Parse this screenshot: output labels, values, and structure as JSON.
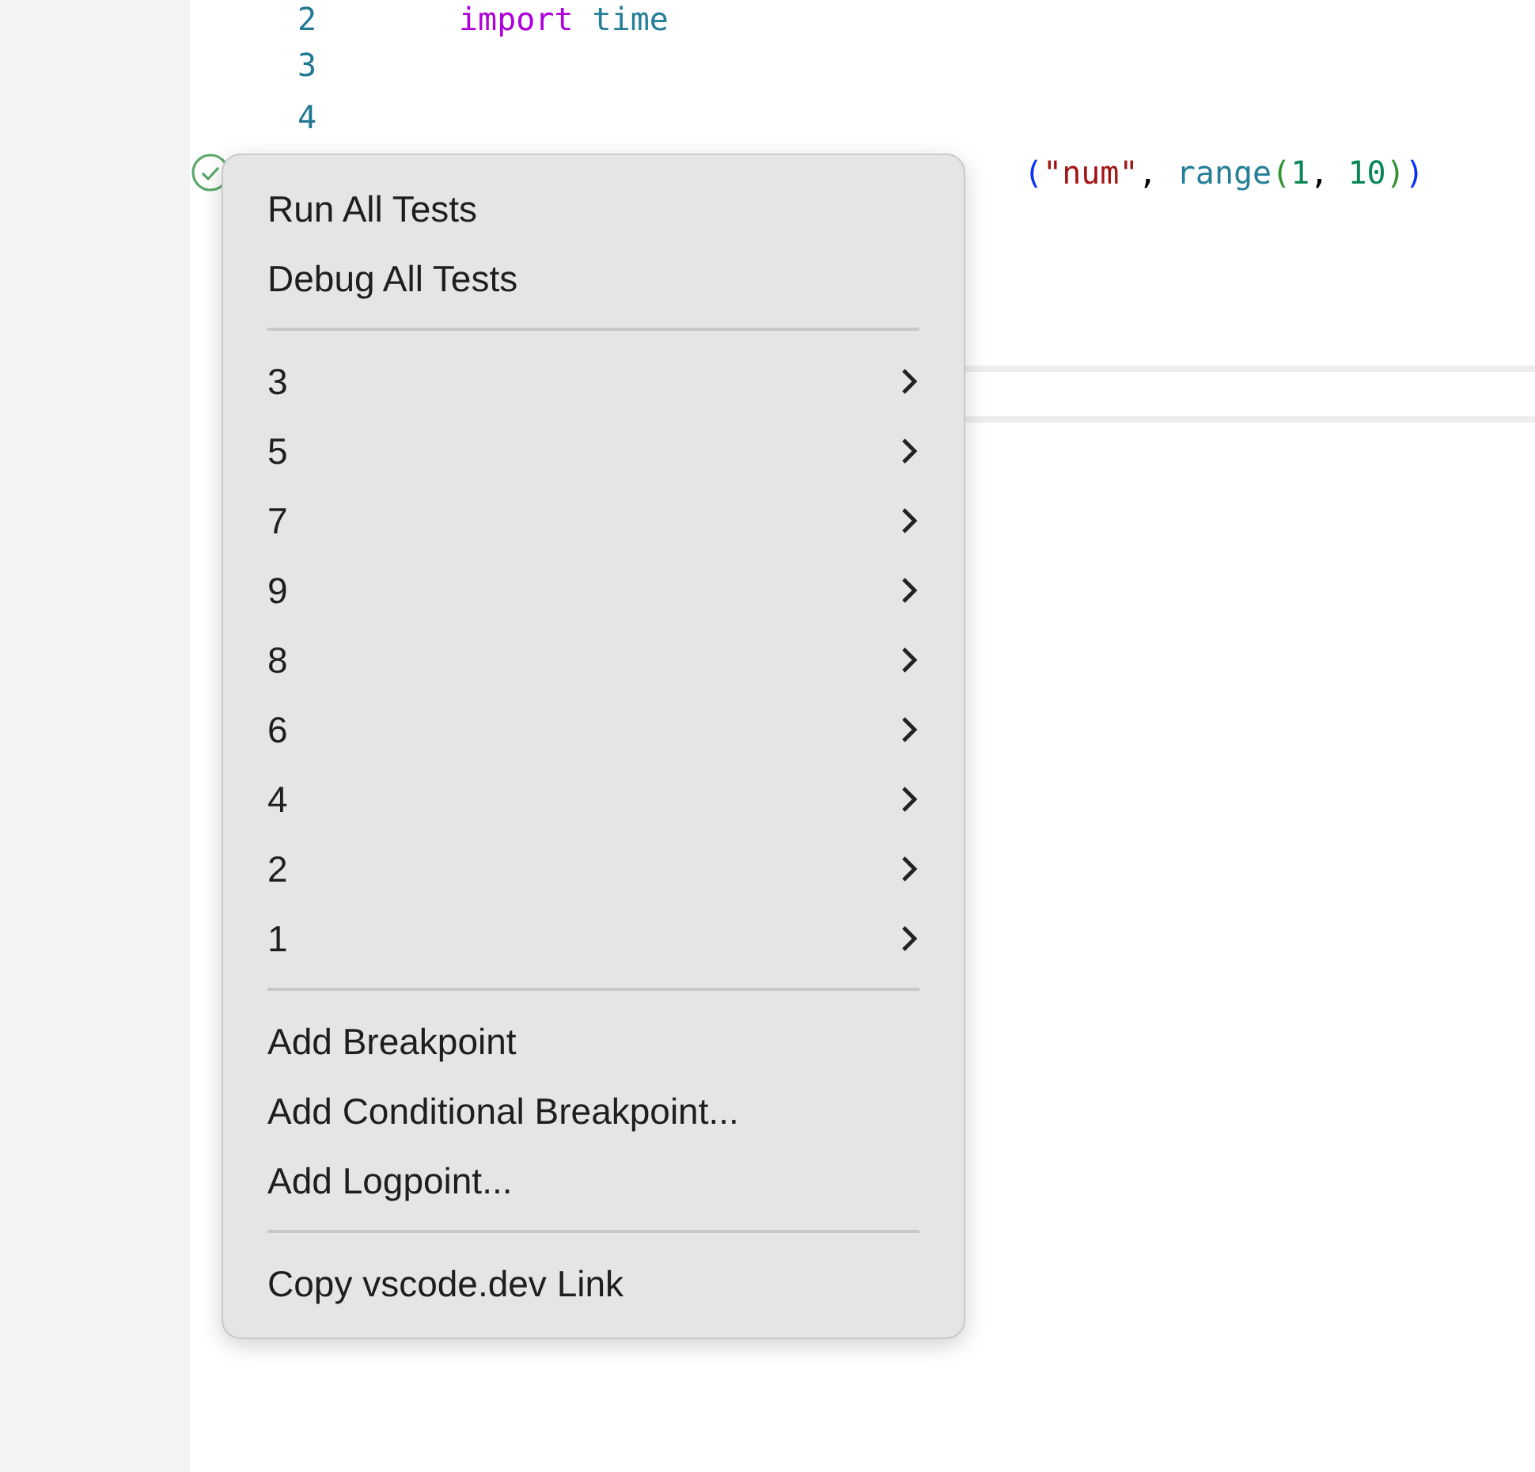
{
  "editor": {
    "lines": [
      {
        "number": "2",
        "tokens": [
          {
            "kind": "keyword",
            "text": "import"
          },
          {
            "kind": "module",
            "text": " time"
          }
        ]
      },
      {
        "number": "3"
      },
      {
        "number": "4"
      },
      {
        "test_passed": true,
        "tokens": [
          {
            "kind": "bracket1",
            "text": "("
          },
          {
            "kind": "string",
            "text": "\"num\""
          },
          {
            "kind": "plain",
            "text": ", "
          },
          {
            "kind": "module",
            "text": "range"
          },
          {
            "kind": "bracket2",
            "text": "("
          },
          {
            "kind": "number",
            "text": "1"
          },
          {
            "kind": "plain",
            "text": ", "
          },
          {
            "kind": "number",
            "text": "10"
          },
          {
            "kind": "bracket2",
            "text": ")"
          },
          {
            "kind": "bracket1",
            "text": ")"
          }
        ]
      }
    ]
  },
  "context_menu": {
    "items": [
      {
        "kind": "action",
        "label": "Run All Tests"
      },
      {
        "kind": "action",
        "label": "Debug All Tests"
      },
      {
        "kind": "separator"
      },
      {
        "kind": "submenu",
        "label": "3"
      },
      {
        "kind": "submenu",
        "label": "5"
      },
      {
        "kind": "submenu",
        "label": "7"
      },
      {
        "kind": "submenu",
        "label": "9"
      },
      {
        "kind": "submenu",
        "label": "8"
      },
      {
        "kind": "submenu",
        "label": "6"
      },
      {
        "kind": "submenu",
        "label": "4"
      },
      {
        "kind": "submenu",
        "label": "2"
      },
      {
        "kind": "submenu",
        "label": "1"
      },
      {
        "kind": "separator"
      },
      {
        "kind": "action",
        "label": "Add Breakpoint"
      },
      {
        "kind": "action",
        "label": "Add Conditional Breakpoint..."
      },
      {
        "kind": "action",
        "label": "Add Logpoint..."
      },
      {
        "kind": "separator"
      },
      {
        "kind": "action",
        "label": "Copy vscode.dev Link"
      }
    ]
  }
}
